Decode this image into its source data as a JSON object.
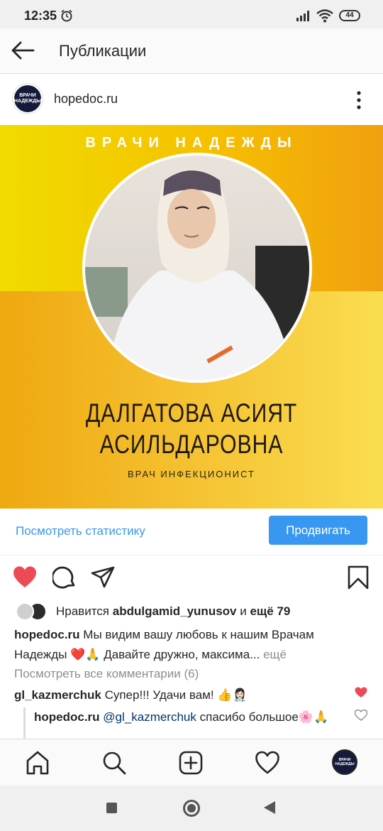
{
  "status_bar": {
    "time": "12:35",
    "battery": "44"
  },
  "header": {
    "title": "Публикации"
  },
  "post": {
    "username": "hopedoc.ru",
    "avatar_text_line1": "ВРАЧИ",
    "avatar_text_line2": "НАДЕЖДЫ",
    "banner_title": "ВРАЧИ НАДЕЖДЫ",
    "doctor_name_line1": "ДАЛГАТОВА АСИЯТ",
    "doctor_name_line2": "АСИЛЬДАРОВНА",
    "doctor_role": "ВРАЧ ИНФЕКЦИОНИСТ"
  },
  "stats": {
    "link": "Посмотреть статистику",
    "promote": "Продвигать"
  },
  "likes": {
    "prefix": "Нравится ",
    "user": "abdulgamid_yunusov",
    "middle": " и ",
    "more": "ещё 79"
  },
  "caption": {
    "user": "hopedoc.ru",
    "text": " Мы видим вашу любовь к нашим Врачам Надежды ❤️🙏 Давайте дружно, максима...",
    "more": " ещё"
  },
  "view_comments": "Посмотреть все комментарии (6)",
  "comment": {
    "user": "gl_kazmerchuk",
    "text": " Супер!!! Удачи вам! 👍👩🏻‍⚕️"
  },
  "reply": {
    "user": "hopedoc.ru",
    "mention": "@gl_kazmerchuk",
    "text": " спасибо большое🌸🙏"
  },
  "colors": {
    "accent": "#3897f0",
    "like_red": "#ed4956",
    "banner_yellow": "#f5b800"
  },
  "icons": [
    "alarm-icon",
    "signal-icon",
    "wifi-icon",
    "back-icon",
    "more-icon",
    "heart-icon",
    "comment-icon",
    "share-icon",
    "bookmark-icon",
    "home-icon",
    "search-icon",
    "add-icon",
    "activity-icon"
  ]
}
